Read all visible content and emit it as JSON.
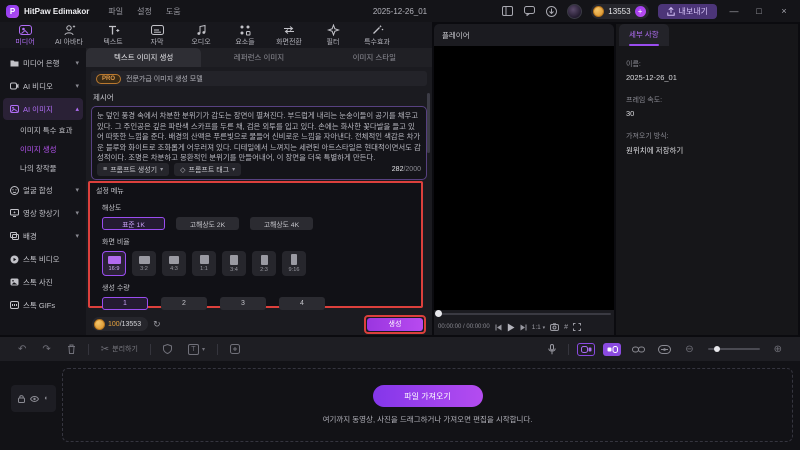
{
  "titlebar": {
    "logo_letter": "P",
    "app_name": "HitPaw Edimakor",
    "menus": [
      {
        "label": "파일"
      },
      {
        "label": "설정"
      },
      {
        "label": "도움"
      }
    ],
    "project_title": "2025-12-26_01",
    "credits_balance": "13553",
    "export_label": "내보내기"
  },
  "ribbon": {
    "items": [
      {
        "label": "미디어"
      },
      {
        "label": "AI 아바타"
      },
      {
        "label": "텍스트"
      },
      {
        "label": "자막"
      },
      {
        "label": "오디오"
      },
      {
        "label": "요소들"
      },
      {
        "label": "화면전환"
      },
      {
        "label": "필터"
      },
      {
        "label": "특수효과"
      }
    ]
  },
  "sidebar": {
    "items": [
      {
        "label": "미디어 은행"
      },
      {
        "label": "AI 비디오"
      },
      {
        "label": "AI 이미지"
      },
      {
        "label": "얼굴 합성"
      },
      {
        "label": "영상 향상기"
      },
      {
        "label": "배경"
      },
      {
        "label": "스톡 비디오"
      },
      {
        "label": "스톡 사진"
      },
      {
        "label": "스톡 GIFs"
      }
    ],
    "ai_image_children": [
      {
        "label": "이미지 특수 효과"
      },
      {
        "label": "이미지 생성"
      },
      {
        "label": "나의 창작물"
      }
    ]
  },
  "generator": {
    "tabs": [
      {
        "label": "텍스트 이미지 생성"
      },
      {
        "label": "레퍼런스 이미지"
      },
      {
        "label": "이미지 스타일"
      }
    ],
    "pro_badge": "PRO",
    "pro_text": "전문가급 이미지 생성 모델",
    "prompt_label": "제시어",
    "prompt_text": "눈 덮인 풍경 속에서 차분한 분위기가 감도는 장면이 펼쳐진다. 부드럽게 내리는 눈송이들이 공기를 채우고 있다. 그 주인공은 깊은 파란색 스카프를 두른 채, 검은 외투를 입고 있다. 손에는 화사한 꽃다발을 들고 있어 따뜻한 느낌을 준다. 배경의 산맥은 푸른빛으로 물들어 신비로운 느낌을 자아낸다. 전체적인 색감은 차가운 블루와 화이트로 조화롭게 어우러져 있다. 디테일에서 느껴지는 세련된 아트스타일은 현대적이면서도 감성적이다. 조명은 차분하고 몽환적인 분위기를 만들어내어, 이 장면을 더욱 특별하게 만든다.",
    "char_count": "282",
    "char_max": "/2000",
    "prompt_generator_label": "프롬프트 생성기",
    "prompt_tag_label": "프롬프트 태그",
    "settings": {
      "title": "설정 메뉴",
      "resolution_label": "해상도",
      "resolutions": [
        {
          "label": "표준 1K",
          "selected": true
        },
        {
          "label": "고해상도 2K",
          "selected": false
        },
        {
          "label": "고해상도 4K",
          "selected": false
        }
      ],
      "ratio_label": "화면 비율",
      "ratios": [
        {
          "label": "16:9",
          "selected": true
        },
        {
          "label": "3:2",
          "selected": false
        },
        {
          "label": "4:3",
          "selected": false
        },
        {
          "label": "1:1",
          "selected": false
        },
        {
          "label": "3:4",
          "selected": false
        },
        {
          "label": "2:3",
          "selected": false
        },
        {
          "label": "9:16",
          "selected": false
        }
      ],
      "quantity_label": "생성 수량",
      "quantities": [
        {
          "label": "1",
          "selected": true
        },
        {
          "label": "2",
          "selected": false
        },
        {
          "label": "3",
          "selected": false
        },
        {
          "label": "4",
          "selected": false
        }
      ]
    },
    "credits_cost": "100",
    "credits_total": "/13553",
    "generate_label": "생성"
  },
  "player": {
    "title": "플레이어",
    "time_display": "00:00:00 / 00:00:00",
    "zoom_ratio": "1:1"
  },
  "details": {
    "tab_label": "세부 사항",
    "fields": [
      {
        "label": "이름:",
        "value": "2025-12-26_01"
      },
      {
        "label": "프레임 속도:",
        "value": "30"
      },
      {
        "label": "가져오기 방식:",
        "value": "원위치에 저장하기"
      }
    ]
  },
  "bottombar": {
    "split_label": "분리하기"
  },
  "timeline": {
    "import_button_label": "파일 가져오기",
    "drop_hint": "여기까지 동영상, 사진을 드래그하거나 가져오면 편집을 시작합니다."
  },
  "icons": {
    "undo": "↶",
    "redo": "↷",
    "scissors": "✂",
    "text_tool": "T",
    "chevron_down": "▾",
    "chevron_up": "▴",
    "zoom_out": "⊖",
    "zoom_in": "⊕",
    "grid": "#",
    "prev_frame": "◀",
    "play": "▶",
    "next_frame": "▶",
    "minimize": "—",
    "maximize": "□",
    "close": "×",
    "plus": "+",
    "prompt_generator": "≡",
    "prompt_tag": "◇",
    "refresh": "↻",
    "contrast": "◐",
    "coin_mark": "●"
  },
  "colors": {
    "accent_purple": "#9a4df0",
    "highlight_red": "#dc403c",
    "coin_orange": "#e8a33d"
  }
}
